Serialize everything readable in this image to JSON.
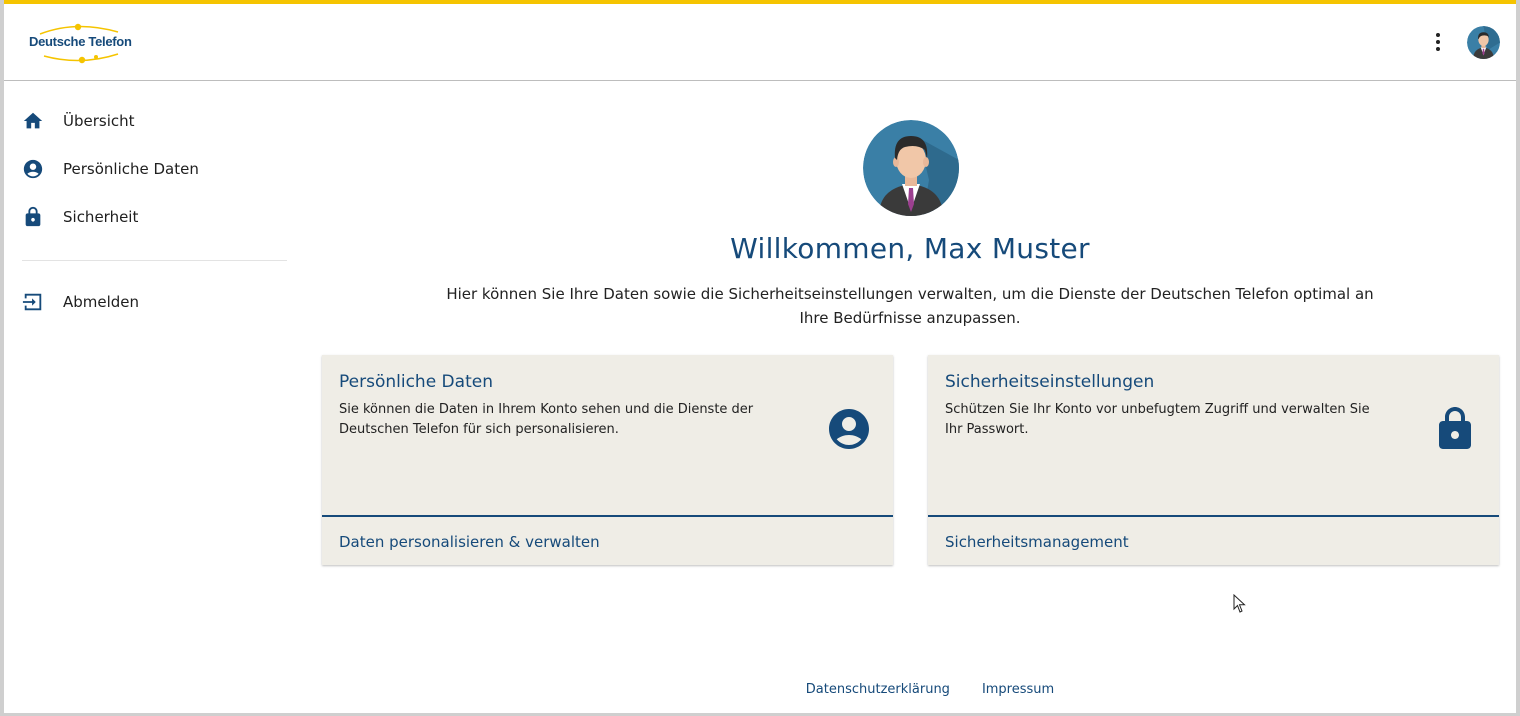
{
  "header": {
    "logo_text": "Deutsche Telefon",
    "menu_icon": "more-vert-icon",
    "avatar_icon": "user-avatar-icon"
  },
  "sidebar": {
    "items": [
      {
        "label": "Übersicht",
        "icon": "home-icon"
      },
      {
        "label": "Persönliche Daten",
        "icon": "account-circle-icon"
      },
      {
        "label": "Sicherheit",
        "icon": "lock-icon"
      },
      {
        "label": "Abmelden",
        "icon": "logout-icon"
      }
    ]
  },
  "main": {
    "welcome": "Willkommen, Max Muster",
    "intro": "Hier können Sie Ihre Daten sowie die Sicherheitseinstellungen verwalten, um die Dienste der Deutschen Telefon optimal an Ihre Bedürfnisse anzupassen.",
    "cards": [
      {
        "title": "Persönliche Daten",
        "text": "Sie können die Daten in Ihrem Konto sehen und die Dienste der Deutschen Telefon für sich personalisieren.",
        "link": "Daten personalisieren & verwalten",
        "icon": "account-circle-icon"
      },
      {
        "title": "Sicherheitseinstellungen",
        "text": "Schützen Sie Ihr Konto vor unbefugtem Zugriff und verwalten Sie Ihr Passwort.",
        "link": "Sicherheitsmanagement",
        "icon": "lock-icon"
      }
    ]
  },
  "footer": {
    "privacy": "Datenschutzerklärung",
    "imprint": "Impressum"
  },
  "colors": {
    "accent_yellow": "#f5c400",
    "brand_blue": "#164a7a",
    "card_bg": "#efede6"
  }
}
